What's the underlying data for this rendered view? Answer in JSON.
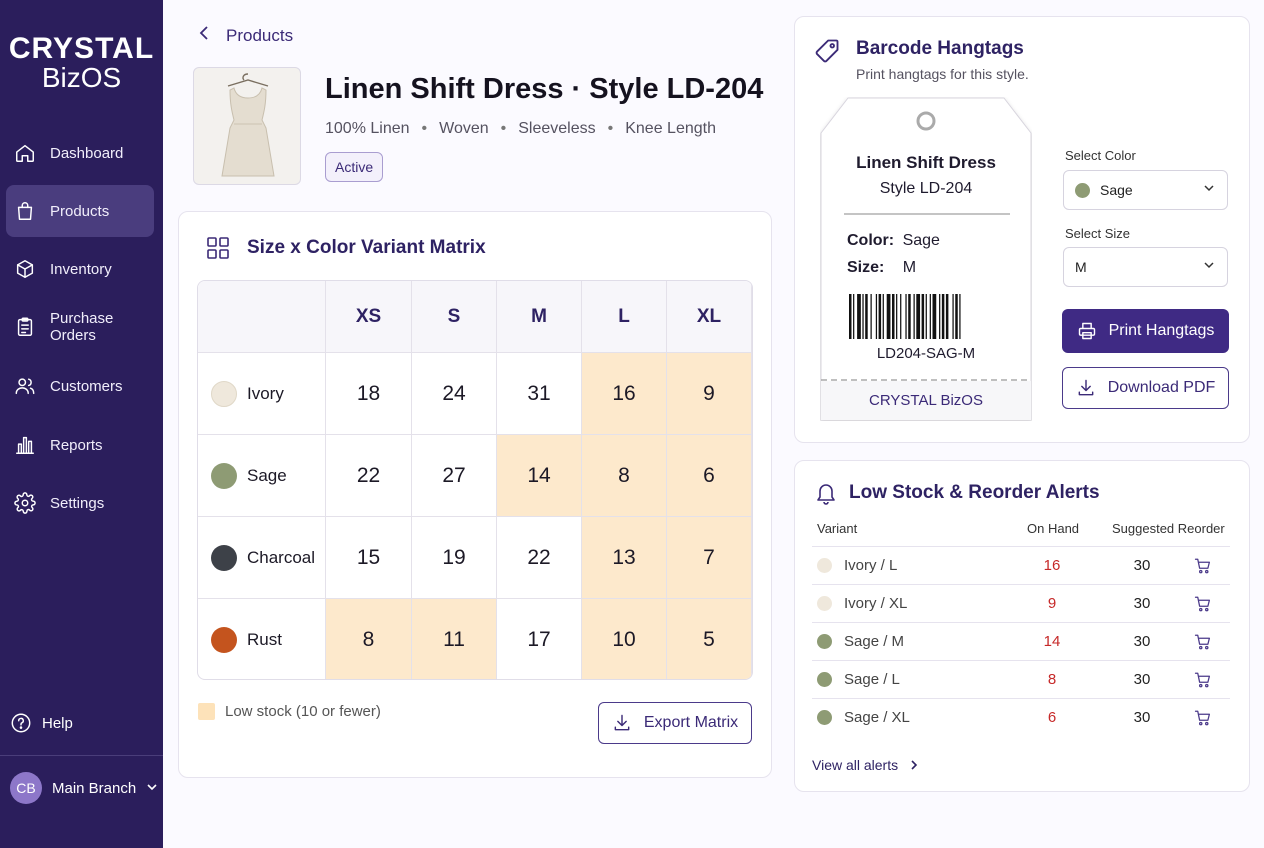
{
  "app": {
    "logo_line1": "CRYSTAL",
    "logo_line2": "BizOS"
  },
  "sidebar": {
    "items": [
      {
        "label": "Dashboard",
        "icon": "home-icon"
      },
      {
        "label": "Products",
        "icon": "shopping-bag-icon",
        "active": true
      },
      {
        "label": "Inventory",
        "icon": "box-icon"
      },
      {
        "label": "Purchase Orders",
        "icon": "clipboard-icon"
      },
      {
        "label": "Customers",
        "icon": "users-icon"
      },
      {
        "label": "Reports",
        "icon": "bar-chart-icon"
      },
      {
        "label": "Settings",
        "icon": "gear-icon"
      }
    ],
    "help_label": "Help",
    "branch": {
      "initials": "CB",
      "name": "Main Branch"
    }
  },
  "breadcrumb": {
    "label": "Products"
  },
  "product": {
    "title": "Linen Shift Dress · Style LD-204",
    "attributes": [
      "100% Linen",
      "Woven",
      "Sleeveless",
      "Knee Length"
    ],
    "status": "Active"
  },
  "matrix": {
    "title": "Size x Color Variant Matrix",
    "sizes": [
      "XS",
      "S",
      "M",
      "L",
      "XL"
    ],
    "rows": [
      {
        "color": "Ivory",
        "swatch": "#efe8dc",
        "values": [
          18,
          24,
          31,
          16,
          9
        ],
        "low": [
          false,
          false,
          false,
          true,
          true
        ]
      },
      {
        "color": "Sage",
        "swatch": "#8e9b74",
        "values": [
          22,
          27,
          14,
          8,
          6
        ],
        "low": [
          false,
          false,
          true,
          true,
          true
        ]
      },
      {
        "color": "Charcoal",
        "swatch": "#3d4148",
        "values": [
          15,
          19,
          22,
          13,
          7
        ],
        "low": [
          false,
          false,
          false,
          true,
          true
        ]
      },
      {
        "color": "Rust",
        "swatch": "#c4541e",
        "values": [
          8,
          11,
          17,
          10,
          5
        ],
        "low": [
          true,
          true,
          false,
          true,
          true
        ]
      }
    ],
    "legend": "Low stock (10 or fewer)",
    "export_label": "Export Matrix",
    "low_color": "#fde9cc"
  },
  "hangtags": {
    "title": "Barcode Hangtags",
    "subtitle": "Print hangtags for this style.",
    "tag": {
      "name": "Linen Shift Dress",
      "style": "Style LD-204",
      "color_label": "Color:",
      "color_value": "Sage",
      "size_label": "Size:",
      "size_value": "M",
      "barcode_text": "LD204-SAG-M",
      "brand": "CRYSTAL BizOS"
    },
    "select_color_label": "Select Color",
    "select_color_value": "Sage",
    "select_size_label": "Select Size",
    "select_size_value": "M",
    "print_label": "Print Hangtags",
    "download_label": "Download PDF"
  },
  "alerts": {
    "title": "Low Stock & Reorder Alerts",
    "col_variant": "Variant",
    "col_onhand": "On Hand",
    "col_reorder": "Suggested Reorder",
    "rows": [
      {
        "variant": "Ivory / L",
        "dot": "#efe8dc",
        "on_hand": "16",
        "reorder": "30"
      },
      {
        "variant": "Ivory / XL",
        "dot": "#efe8dc",
        "on_hand": "9",
        "reorder": "30"
      },
      {
        "variant": "Sage / M",
        "dot": "#8e9b74",
        "on_hand": "14",
        "reorder": "30"
      },
      {
        "variant": "Sage / L",
        "dot": "#8e9b74",
        "on_hand": "8",
        "reorder": "30"
      },
      {
        "variant": "Sage / XL",
        "dot": "#8e9b74",
        "on_hand": "6",
        "reorder": "30"
      }
    ],
    "view_all": "View all alerts"
  }
}
